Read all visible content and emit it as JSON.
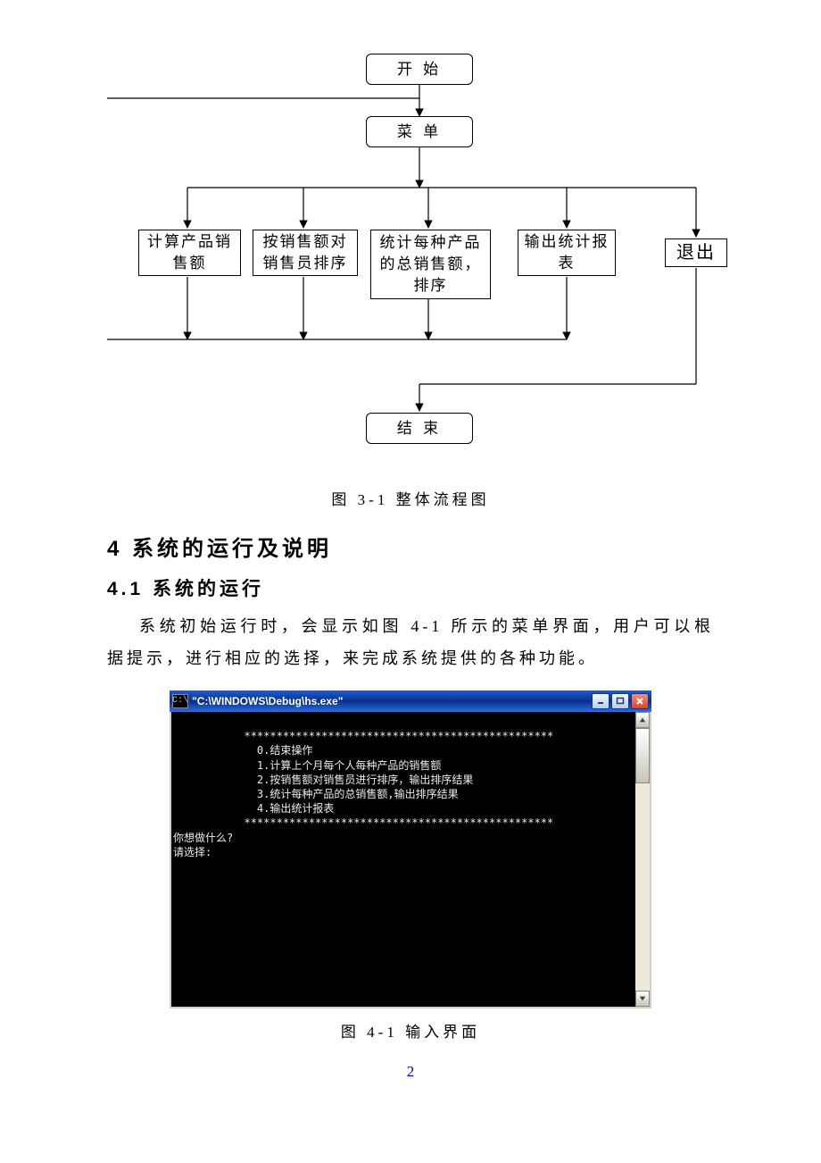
{
  "flow": {
    "start": "开  始",
    "menu": "菜  单",
    "opt1": "计算产品销售额",
    "opt2": "按销售额对销售员排序",
    "opt3": "统计每种产品的总销售额，排序",
    "opt4": "输出统计报表",
    "opt5": "退出",
    "end": "结  束",
    "caption": "图 3-1 整体流程图"
  },
  "headings": {
    "h2": "4 系统的运行及说明",
    "h3": "4.1 系统的运行"
  },
  "paragraph": "系统初始运行时，会显示如图 4-1 所示的菜单界面，用户可以根据提示，进行相应的选择，来完成系统提供的各种功能。",
  "console": {
    "title": "\"C:\\WINDOWS\\Debug\\hs.exe\"",
    "icon_label": "C:\\",
    "lines": [
      "",
      "           ************************************************",
      "             0.结束操作",
      "             1.计算上个月每个人每种产品的销售额",
      "             2.按销售额对销售员进行排序，输出排序结果",
      "             3.统计每种产品的总销售额,输出排序结果",
      "             4.输出统计报表",
      "           ************************************************",
      "你想做什么?",
      "请选择:"
    ]
  },
  "console_caption": "图 4-1 输入界面",
  "page_number": "2"
}
